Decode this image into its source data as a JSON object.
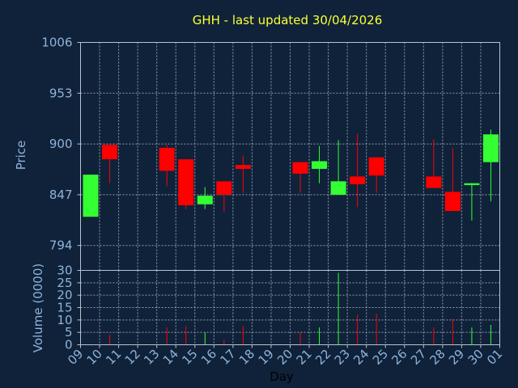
{
  "chart_data": {
    "type": "candlestick",
    "title": "GHH - last updated 30/04/2026",
    "ylabel_price": "Price",
    "ylabel_volume": "Volume (0000)",
    "xlabel": "Day",
    "price_ylim": [
      768,
      1006
    ],
    "price_ticks": [
      "1006",
      "953",
      "900",
      "847",
      "794"
    ],
    "price_tick_values": [
      1006,
      953,
      900,
      847,
      794
    ],
    "volume_ylim": [
      0,
      30
    ],
    "volume_ticks": [
      "30",
      "25",
      "20",
      "15",
      "10",
      "5",
      "0"
    ],
    "volume_tick_values": [
      30,
      25,
      20,
      15,
      10,
      5,
      0
    ],
    "x_tick_labels": [
      "09",
      "10",
      "11",
      "12",
      "13",
      "14",
      "15",
      "16",
      "17",
      "18",
      "19",
      "20",
      "21",
      "22",
      "23",
      "24",
      "25",
      "26",
      "27",
      "28",
      "29",
      "30",
      "01"
    ],
    "grid": true,
    "colors": {
      "up": "#33ff33",
      "down": "#ff0000",
      "background": "#0f223a",
      "title": "#ffff33",
      "axis_text": "#8fb3d9"
    },
    "candles": [
      {
        "day": "09",
        "open": 824,
        "close": 868,
        "high": 868,
        "low": 824,
        "volume": 0
      },
      {
        "day": "10",
        "open": 899,
        "close": 884,
        "high": 899,
        "low": 859,
        "volume": 4
      },
      {
        "day": "13",
        "open": 896,
        "close": 872,
        "high": 899,
        "low": 856,
        "volume": 7
      },
      {
        "day": "14",
        "open": 884,
        "close": 836,
        "high": 884,
        "low": 832,
        "volume": 7.5
      },
      {
        "day": "15",
        "open": 837,
        "close": 846,
        "high": 855,
        "low": 832,
        "volume": 5
      },
      {
        "day": "16",
        "open": 861,
        "close": 847,
        "high": 861,
        "low": 829,
        "volume": 2
      },
      {
        "day": "17",
        "open": 878,
        "close": 874,
        "high": 888,
        "low": 849,
        "volume": 7.5
      },
      {
        "day": "20",
        "open": 881,
        "close": 869,
        "high": 881,
        "low": 849,
        "volume": 5
      },
      {
        "day": "21",
        "open": 874,
        "close": 882,
        "high": 898,
        "low": 859,
        "volume": 7
      },
      {
        "day": "22",
        "open": 847,
        "close": 861,
        "high": 904,
        "low": 847,
        "volume": 29
      },
      {
        "day": "23",
        "open": 866,
        "close": 858,
        "high": 911,
        "low": 834,
        "volume": 12
      },
      {
        "day": "24",
        "open": 886,
        "close": 867,
        "high": 886,
        "low": 849,
        "volume": 12.5
      },
      {
        "day": "27",
        "open": 866,
        "close": 854,
        "high": 905,
        "low": 854,
        "volume": 7
      },
      {
        "day": "28",
        "open": 850,
        "close": 830,
        "high": 896,
        "low": 830,
        "volume": 10.5
      },
      {
        "day": "29",
        "open": 857,
        "close": 859,
        "high": 859,
        "low": 820,
        "volume": 7
      },
      {
        "day": "30",
        "open": 881,
        "close": 910,
        "high": 915,
        "low": 840,
        "volume": 8
      }
    ]
  }
}
